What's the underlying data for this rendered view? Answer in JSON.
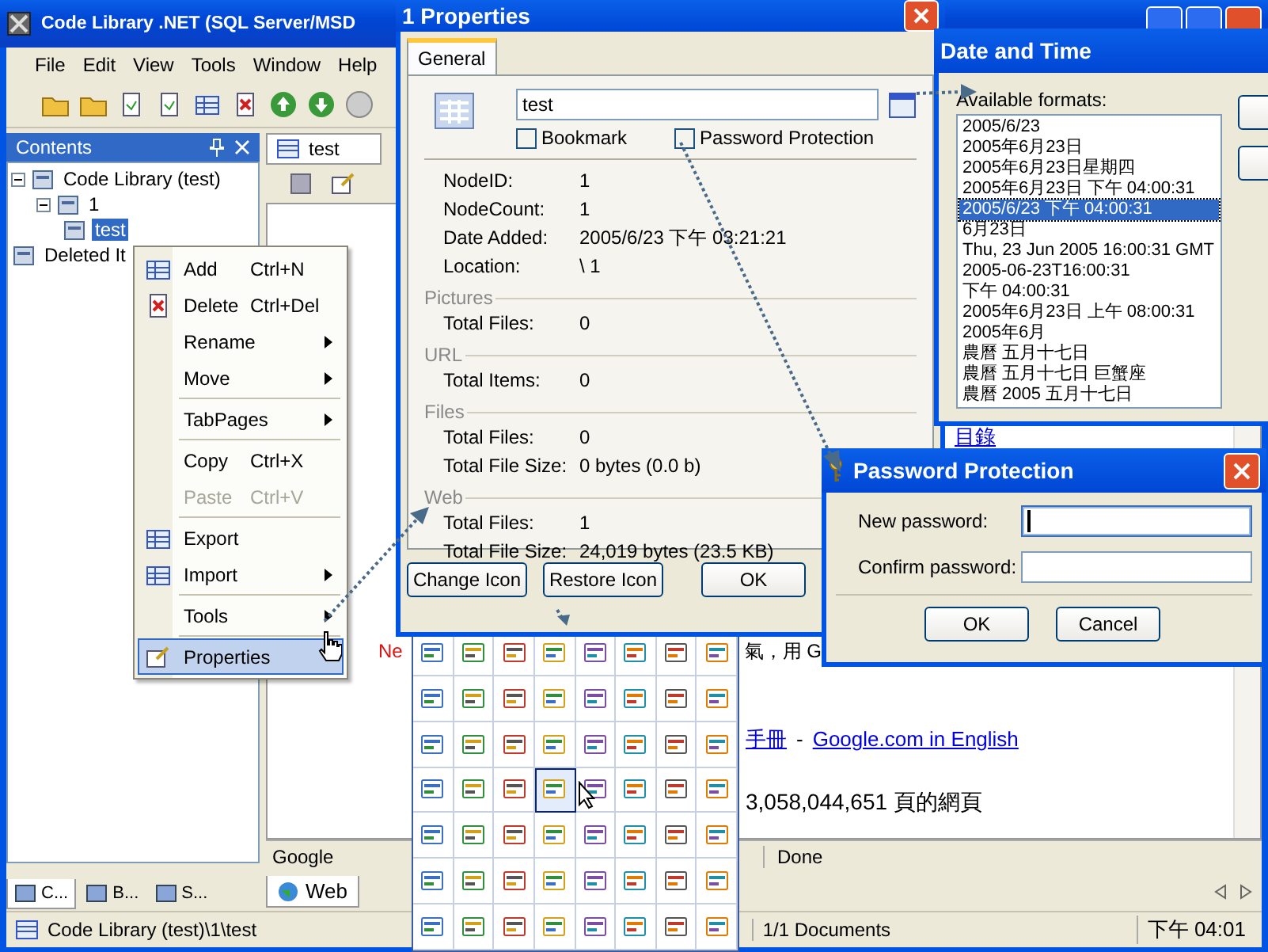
{
  "main_window": {
    "title": "Code Library .NET (SQL Server/MSD",
    "menu": [
      "File",
      "Edit",
      "View",
      "Tools",
      "Window",
      "Help"
    ],
    "contents_pane": {
      "title": "Contents",
      "tree": [
        {
          "label": "Code Library (test)",
          "expanded": true,
          "selected": false,
          "children": [
            {
              "label": "1",
              "expanded": true,
              "selected": false,
              "children": [
                {
                  "label": "test",
                  "selected": true
                }
              ]
            }
          ]
        },
        {
          "label": "Deleted It",
          "selected": false
        }
      ]
    },
    "pane_tabs": [
      {
        "label": "C...",
        "selected": true
      },
      {
        "label": "B...",
        "selected": false
      },
      {
        "label": "S...",
        "selected": false
      }
    ],
    "document_tab": "test",
    "web_page": {
      "toc_link": "目錄",
      "news_label": "Ne",
      "news_text": "氣，用 G",
      "manual_link": "手冊",
      "dash": "-",
      "english_link": "Google.com in English",
      "page_count": "3,058,044,651 頁的網頁"
    },
    "browser_status": {
      "left": "Google",
      "right": "Done"
    },
    "browser_tabs": [
      {
        "label": "Web",
        "selected": true
      }
    ],
    "status_bar": {
      "path": "Code Library (test)\\1\\test",
      "documents": "1/1 Documents",
      "time": "下午 04:01"
    }
  },
  "context_menu": {
    "items": [
      {
        "kind": "item",
        "label": "Add",
        "shortcut": "Ctrl+N",
        "disabled": false,
        "submenu": false,
        "highlighted": false
      },
      {
        "kind": "item",
        "label": "Delete",
        "shortcut": "Ctrl+Del",
        "disabled": false,
        "submenu": false,
        "highlighted": false
      },
      {
        "kind": "item",
        "label": "Rename",
        "disabled": false,
        "submenu": true,
        "highlighted": false
      },
      {
        "kind": "item",
        "label": "Move",
        "disabled": false,
        "submenu": true,
        "highlighted": false
      },
      {
        "kind": "separator"
      },
      {
        "kind": "item",
        "label": "TabPages",
        "disabled": false,
        "submenu": true,
        "highlighted": false
      },
      {
        "kind": "separator"
      },
      {
        "kind": "item",
        "label": "Copy",
        "shortcut": "Ctrl+X",
        "disabled": false,
        "submenu": false,
        "highlighted": false
      },
      {
        "kind": "item",
        "label": "Paste",
        "shortcut": "Ctrl+V",
        "disabled": true,
        "submenu": false,
        "highlighted": false
      },
      {
        "kind": "separator"
      },
      {
        "kind": "item",
        "label": "Export",
        "disabled": false,
        "submenu": false,
        "highlighted": false
      },
      {
        "kind": "item",
        "label": "Import",
        "disabled": false,
        "submenu": true,
        "highlighted": false
      },
      {
        "kind": "separator"
      },
      {
        "kind": "item",
        "label": "Tools",
        "disabled": false,
        "submenu": true,
        "highlighted": false
      },
      {
        "kind": "separator"
      },
      {
        "kind": "item",
        "label": "Properties",
        "disabled": false,
        "submenu": false,
        "highlighted": true
      }
    ]
  },
  "properties_dialog": {
    "title": "1 Properties",
    "tabs": [
      {
        "label": "General",
        "selected": true
      }
    ],
    "name_value": "test",
    "checkboxes": [
      {
        "label": "Bookmark",
        "checked": false
      },
      {
        "label": "Password Protection",
        "checked": false
      }
    ],
    "fields": [
      {
        "label": "NodeID:",
        "value": "1"
      },
      {
        "label": "NodeCount:",
        "value": "1"
      },
      {
        "label": "Date Added:",
        "value": "2005/6/23 下午 03:21:21"
      },
      {
        "label": "Location:",
        "value": "\\ 1"
      }
    ],
    "sections": [
      {
        "title": "Pictures",
        "fields": [
          {
            "label": "Total Files:",
            "value": "0"
          }
        ]
      },
      {
        "title": "URL",
        "fields": [
          {
            "label": "Total Items:",
            "value": "0"
          }
        ]
      },
      {
        "title": "Files",
        "fields": [
          {
            "label": "Total Files:",
            "value": "0"
          },
          {
            "label": "Total File Size:",
            "value": "0 bytes (0.0 b)"
          }
        ]
      },
      {
        "title": "Web",
        "fields": [
          {
            "label": "Total Files:",
            "value": "1"
          },
          {
            "label": "Total File Size:",
            "value": "24,019 bytes (23.5 KB)"
          }
        ]
      }
    ],
    "buttons": [
      "Change Icon",
      "Restore Icon",
      "OK"
    ]
  },
  "date_time_dialog": {
    "title": "Date and Time",
    "list_label": "Available formats:",
    "formats": [
      {
        "text": "2005/6/23",
        "selected": false
      },
      {
        "text": "2005年6月23日",
        "selected": false
      },
      {
        "text": "2005年6月23日星期四",
        "selected": false
      },
      {
        "text": "2005年6月23日 下午 04:00:31",
        "selected": false
      },
      {
        "text": "2005/6/23 下午 04:00:31",
        "selected": true
      },
      {
        "text": "6月23日",
        "selected": false
      },
      {
        "text": "Thu, 23 Jun 2005 16:00:31 GMT",
        "selected": false
      },
      {
        "text": "2005-06-23T16:00:31",
        "selected": false
      },
      {
        "text": "下午 04:00:31",
        "selected": false
      },
      {
        "text": "2005年6月23日 上午 08:00:31",
        "selected": false
      },
      {
        "text": "2005年6月",
        "selected": false
      },
      {
        "text": "農曆 五月十七日",
        "selected": false
      },
      {
        "text": "農曆 五月十七日 巨蟹座",
        "selected": false
      },
      {
        "text": "農曆 2005 五月十七日",
        "selected": false
      }
    ]
  },
  "password_dialog": {
    "title": "Password Protection",
    "fields": [
      {
        "label": "New password:",
        "focused": true
      },
      {
        "label": "Confirm password:",
        "focused": false
      }
    ],
    "buttons": [
      "OK",
      "Cancel"
    ]
  },
  "icon_picker": {
    "cells": [
      {
        "selected": false
      },
      {
        "selected": false
      },
      {
        "selected": false
      },
      {
        "selected": false
      },
      {
        "selected": false
      },
      {
        "selected": false
      },
      {
        "selected": false
      },
      {
        "selected": false
      },
      {
        "selected": false
      },
      {
        "selected": false
      },
      {
        "selected": false
      },
      {
        "selected": false
      },
      {
        "selected": false
      },
      {
        "selected": false
      },
      {
        "selected": false
      },
      {
        "selected": false
      },
      {
        "selected": false
      },
      {
        "selected": false
      },
      {
        "selected": false
      },
      {
        "selected": false
      },
      {
        "selected": false
      },
      {
        "selected": false
      },
      {
        "selected": false
      },
      {
        "selected": false
      },
      {
        "selected": false
      },
      {
        "selected": false
      },
      {
        "selected": false
      },
      {
        "selected": true
      },
      {
        "selected": false
      },
      {
        "selected": false
      },
      {
        "selected": false
      },
      {
        "selected": false
      },
      {
        "selected": false
      },
      {
        "selected": false
      },
      {
        "selected": false
      },
      {
        "selected": false
      },
      {
        "selected": false
      },
      {
        "selected": false
      },
      {
        "selected": false
      },
      {
        "selected": false
      },
      {
        "selected": false
      },
      {
        "selected": false
      },
      {
        "selected": false
      },
      {
        "selected": false
      },
      {
        "selected": false
      },
      {
        "selected": false
      },
      {
        "selected": false
      },
      {
        "selected": false
      },
      {
        "selected": false
      },
      {
        "selected": false
      },
      {
        "selected": false
      },
      {
        "selected": false
      },
      {
        "selected": false
      },
      {
        "selected": false
      },
      {
        "selected": false
      },
      {
        "selected": false
      }
    ]
  }
}
